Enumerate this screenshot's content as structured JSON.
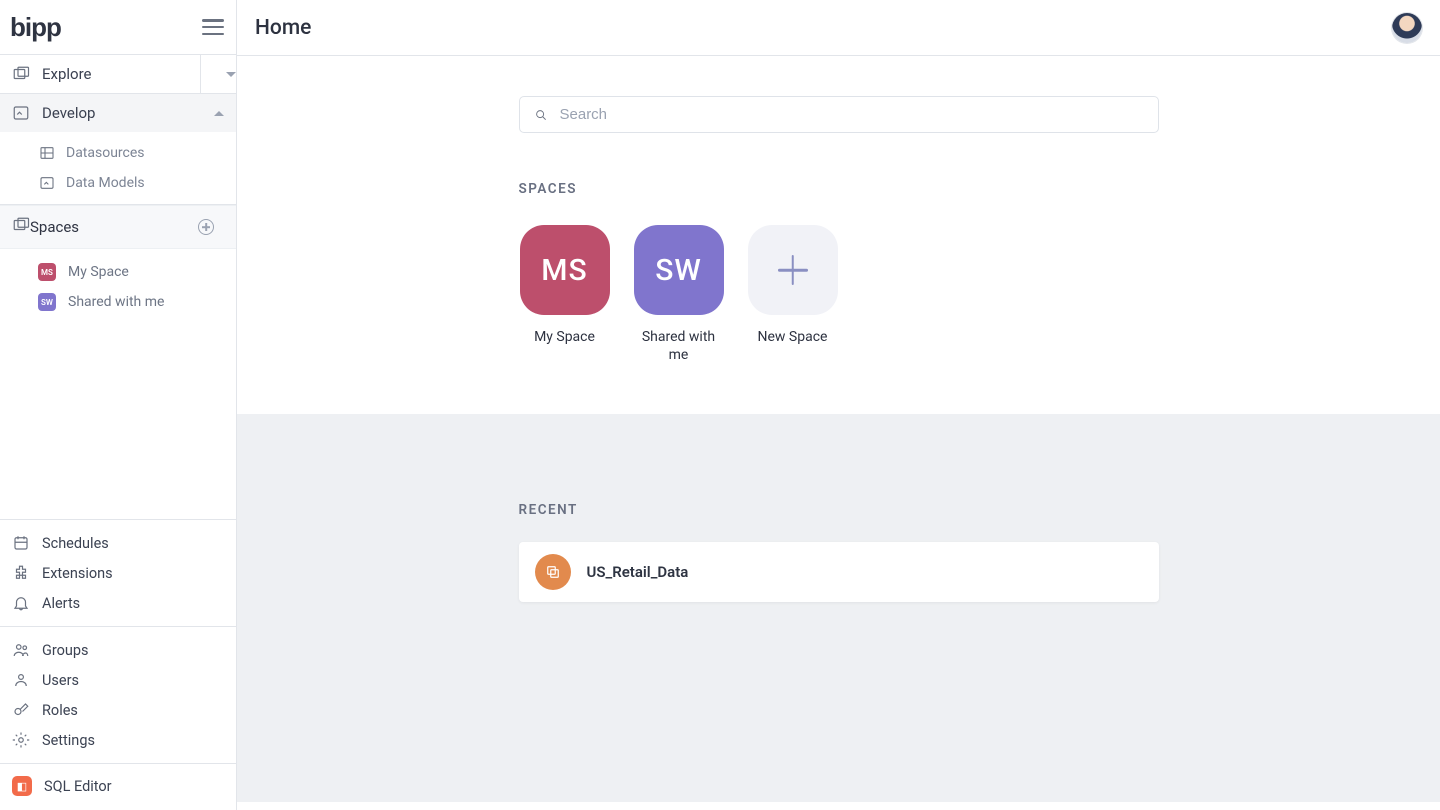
{
  "brand": "bipp",
  "page_title": "Home",
  "search": {
    "placeholder": "Search"
  },
  "sidebar": {
    "explore_label": "Explore",
    "develop_label": "Develop",
    "develop_children": {
      "datasources": "Datasources",
      "data_models": "Data Models"
    },
    "spaces_label": "Spaces",
    "spaces": [
      {
        "abbr": "MS",
        "label": "My Space",
        "color": "bg-rose"
      },
      {
        "abbr": "SW",
        "label": "Shared with me",
        "color": "bg-purple"
      }
    ],
    "mid_items": {
      "schedules": "Schedules",
      "extensions": "Extensions",
      "alerts": "Alerts"
    },
    "admin_items": {
      "groups": "Groups",
      "users": "Users",
      "roles": "Roles",
      "settings": "Settings"
    },
    "sql_editor": "SQL Editor"
  },
  "sections": {
    "spaces": "SPACES",
    "recent": "RECENT"
  },
  "spaces_grid": [
    {
      "abbr": "MS",
      "label": "My Space",
      "color": "bg-rose"
    },
    {
      "abbr": "SW",
      "label": "Shared with me",
      "color": "bg-purple"
    }
  ],
  "new_space_label": "New Space",
  "recent": [
    {
      "name": "US_Retail_Data"
    }
  ]
}
